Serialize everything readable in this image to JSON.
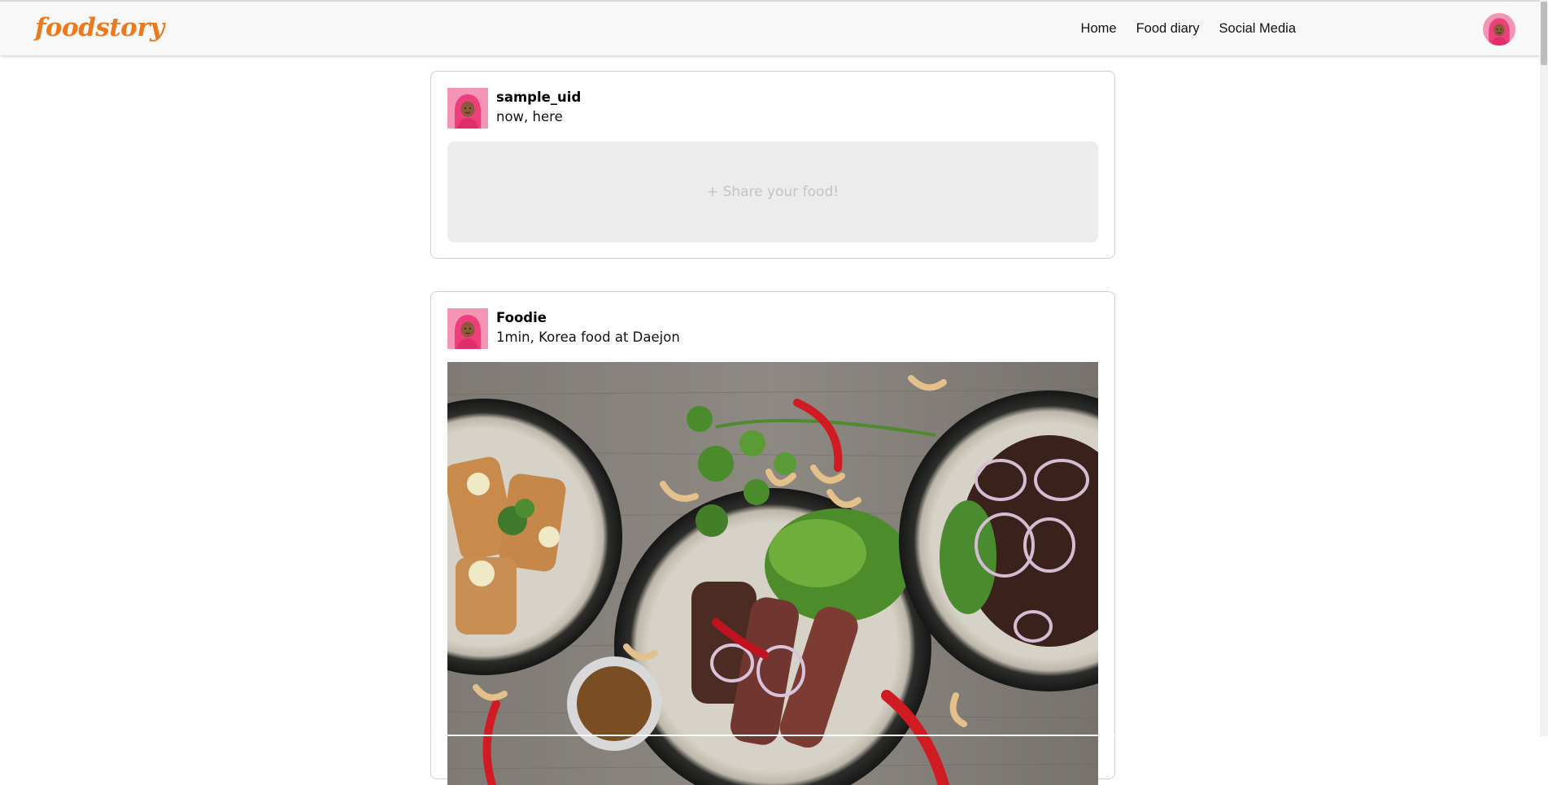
{
  "navbar": {
    "brand": "foodstory",
    "links": [
      {
        "label": "Home"
      },
      {
        "label": "Food diary"
      },
      {
        "label": "Social Media"
      }
    ]
  },
  "compose": {
    "username": "sample_uid",
    "meta": "now, here",
    "placeholder": "+ Share your food!"
  },
  "post": {
    "username": "Foodie",
    "meta": "1min, Korea food at Daejon"
  },
  "colors": {
    "brand": "#ec7a1c",
    "navbar_bg": "#f8f8f8",
    "compose_bg": "#ececec",
    "avatar_bg": "#f58fb0"
  },
  "icons": {
    "nav_avatar": "user-avatar-icon",
    "post_avatar": "user-avatar-icon"
  }
}
